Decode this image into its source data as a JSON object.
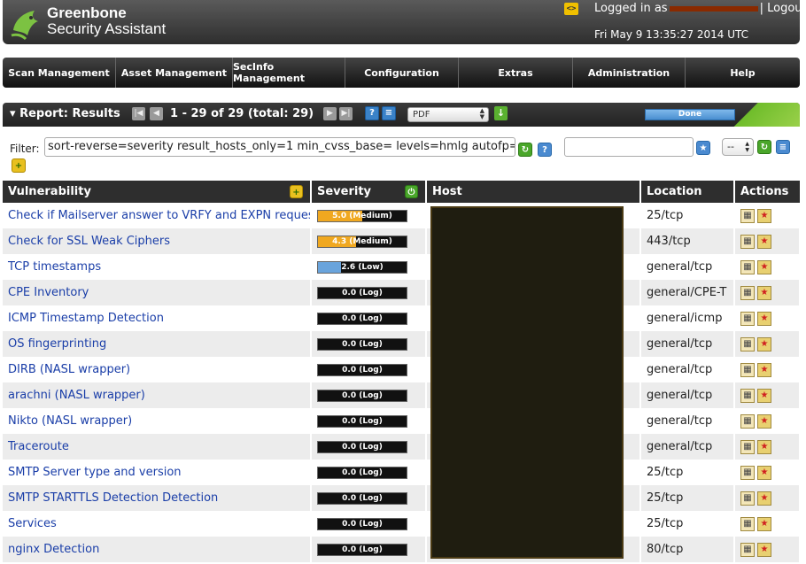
{
  "header": {
    "brand_line1": "Greenbone",
    "brand_line2": "Security Assistant",
    "logged_in_prefix": "Logged in as",
    "logged_in_suffix": "|",
    "logout_label": "Logout",
    "datetime": "Fri May 9 13:35:27 2014 UTC"
  },
  "nav": {
    "items": [
      "Scan Management",
      "Asset Management",
      "SecInfo Management",
      "Configuration",
      "Extras",
      "Administration",
      "Help"
    ]
  },
  "report": {
    "title": "Report: Results",
    "pagination": "1 - 29 of 29 (total: 29)",
    "format": "PDF",
    "status": "Done"
  },
  "filter": {
    "label": "Filter:",
    "value": "sort-reverse=severity result_hosts_only=1 min_cvss_base= levels=hmlg autofp=",
    "select_value": "--"
  },
  "table": {
    "headers": {
      "vulnerability": "Vulnerability",
      "severity": "Severity",
      "host": "Host",
      "location": "Location",
      "actions": "Actions"
    },
    "rows": [
      {
        "name": "Check if Mailserver answer to VRFY and EXPN requests",
        "severity_label": "5.0 (Medium)",
        "severity": 5.0,
        "location": "25/tcp"
      },
      {
        "name": "Check for SSL Weak Ciphers",
        "severity_label": "4.3 (Medium)",
        "severity": 4.3,
        "location": "443/tcp"
      },
      {
        "name": "TCP timestamps",
        "severity_label": "2.6 (Low)",
        "severity": 2.6,
        "location": "general/tcp"
      },
      {
        "name": "CPE Inventory",
        "severity_label": "0.0 (Log)",
        "severity": 0.0,
        "location": "general/CPE-T"
      },
      {
        "name": "ICMP Timestamp Detection",
        "severity_label": "0.0 (Log)",
        "severity": 0.0,
        "location": "general/icmp"
      },
      {
        "name": "OS fingerprinting",
        "severity_label": "0.0 (Log)",
        "severity": 0.0,
        "location": "general/tcp"
      },
      {
        "name": "DIRB (NASL wrapper)",
        "severity_label": "0.0 (Log)",
        "severity": 0.0,
        "location": "general/tcp"
      },
      {
        "name": "arachni (NASL wrapper)",
        "severity_label": "0.0 (Log)",
        "severity": 0.0,
        "location": "general/tcp"
      },
      {
        "name": "Nikto (NASL wrapper)",
        "severity_label": "0.0 (Log)",
        "severity": 0.0,
        "location": "general/tcp"
      },
      {
        "name": "Traceroute",
        "severity_label": "0.0 (Log)",
        "severity": 0.0,
        "location": "general/tcp"
      },
      {
        "name": "SMTP Server type and version",
        "severity_label": "0.0 (Log)",
        "severity": 0.0,
        "location": "25/tcp"
      },
      {
        "name": "SMTP STARTTLS Detection Detection",
        "severity_label": "0.0 (Log)",
        "severity": 0.0,
        "location": "25/tcp"
      },
      {
        "name": "Services",
        "severity_label": "0.0 (Log)",
        "severity": 0.0,
        "location": "25/tcp"
      },
      {
        "name": "nginx Detection",
        "severity_label": "0.0 (Log)",
        "severity": 0.0,
        "location": "80/tcp"
      }
    ]
  },
  "colors": {
    "medium": "#f0a820",
    "low": "#6aa4dc",
    "accent_green": "#6fbd2b"
  }
}
